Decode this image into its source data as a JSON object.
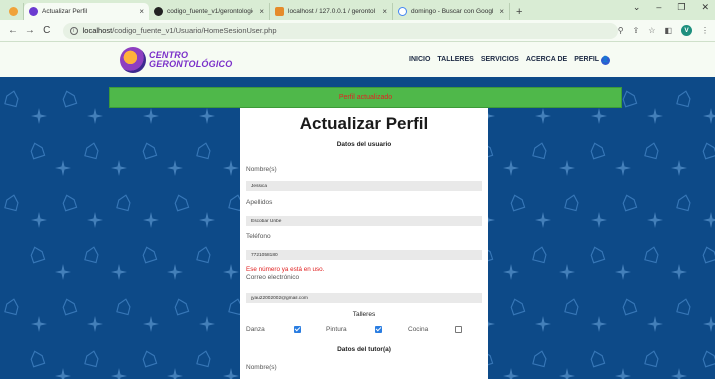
{
  "browser": {
    "tabs": [
      {
        "label": "Actualizar Perfil",
        "active": true,
        "icon": "site-favicon"
      },
      {
        "label": "codigo_fuente_v1/gerontologic",
        "active": false,
        "icon": "github-icon"
      },
      {
        "label": "localhost / 127.0.0.1 / gerontol",
        "active": false,
        "icon": "phpmyadmin-icon"
      },
      {
        "label": "domingo - Buscar con Google",
        "active": false,
        "icon": "google-icon"
      }
    ],
    "new_tab": "+",
    "url_host": "localhost",
    "url_path": "/codigo_fuente_v1/Usuario/HomeSesionUser.php",
    "profile_initial": "V"
  },
  "site": {
    "logo_line1": "CENTRO",
    "logo_line2": "GERONTOLÓGICO",
    "nav": [
      "INICIO",
      "TALLERES",
      "SERVICIOS",
      "ACERCA DE",
      "PERFIL"
    ]
  },
  "banner": {
    "text": "Perfil actualizado"
  },
  "form": {
    "title": "Actualizar Perfil",
    "section_user": "Datos del usuario",
    "nombre_label": "Nombre(s)",
    "nombre_value": "Jessica",
    "apellidos_label": "Apellidos",
    "apellidos_value": "Escobar Uribe",
    "telefono_label": "Teléfono",
    "telefono_value": "7721058180",
    "telefono_error": "Ese número ya está en uso.",
    "correo_label": "Correo electrónico",
    "correo_value": "jyau22002002@gmail.com",
    "talleres_label": "Talleres",
    "talleres": [
      {
        "name": "Danza",
        "checked": true
      },
      {
        "name": "Pintura",
        "checked": true
      },
      {
        "name": "Cocina",
        "checked": false
      }
    ],
    "section_tutor": "Datos del tutor(a)",
    "tutor_nombre_label": "Nombre(s)"
  },
  "colors": {
    "banner_bg": "#4fb84a",
    "banner_text": "#e22222",
    "pattern_bg": "#0d4a88",
    "checkbox_on": "#2a7de1",
    "logo_purple": "#7a2fc9"
  }
}
